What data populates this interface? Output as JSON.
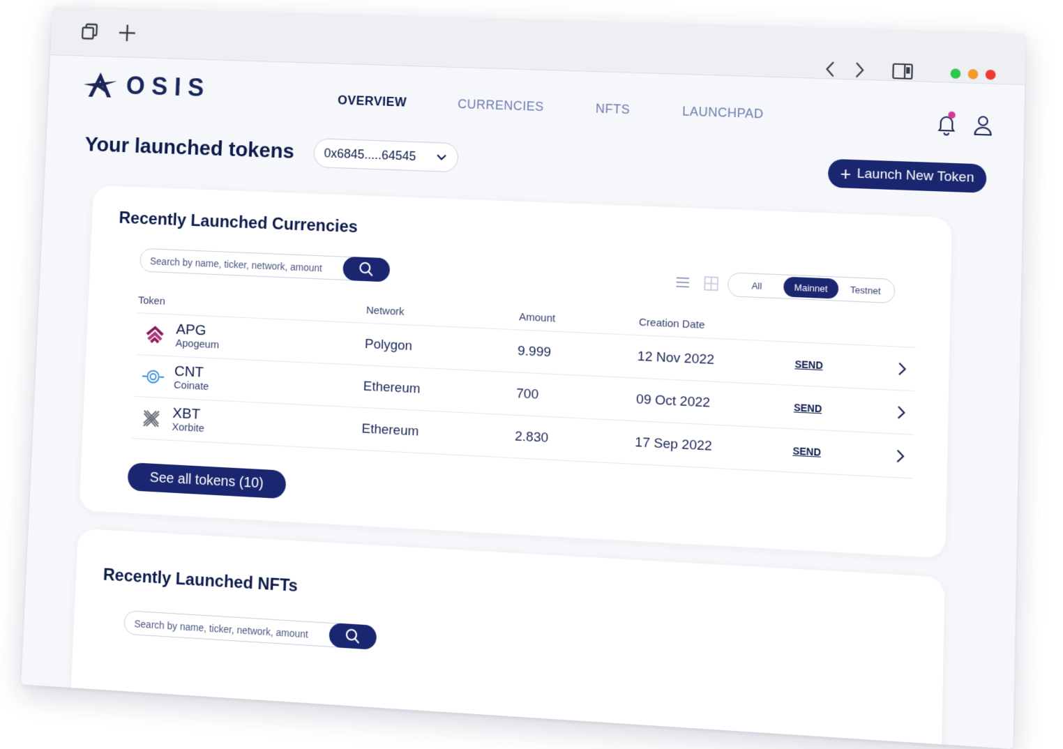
{
  "browser": {
    "icons": [
      "tabs-icon",
      "new-tab-icon",
      "back-icon",
      "forward-icon",
      "sidebar-icon"
    ],
    "traffic_lights": [
      "#2fc84b",
      "#f29c2a",
      "#ee3b33"
    ]
  },
  "header": {
    "logo_text": "OSIS",
    "nav": [
      {
        "label": "OVERVIEW",
        "active": true
      },
      {
        "label": "CURRENCIES",
        "active": false
      },
      {
        "label": "NFTS",
        "active": false
      },
      {
        "label": "LAUNCHPAD",
        "active": false
      }
    ]
  },
  "page": {
    "title": "Your launched tokens",
    "wallet": "0x6845.....64545",
    "launch_button": "Launch New Token"
  },
  "currencies": {
    "title": "Recently Launched Currencies",
    "search_placeholder": "Search by name, ticker, network, amount",
    "filters": [
      {
        "label": "All",
        "active": false
      },
      {
        "label": "Mainnet",
        "active": true
      },
      {
        "label": "Testnet",
        "active": false
      }
    ],
    "columns": {
      "token": "Token",
      "network": "Network",
      "amount": "Amount",
      "date": "Creation Date"
    },
    "rows": [
      {
        "ticker": "APG",
        "name": "Apogeum",
        "network": "Polygon",
        "amount": "9.999",
        "date": "12 Nov 2022",
        "action": "SEND",
        "icon": "apogeum-icon"
      },
      {
        "ticker": "CNT",
        "name": "Coinate",
        "network": "Ethereum",
        "amount": "700",
        "date": "09 Oct 2022",
        "action": "SEND",
        "icon": "coinate-icon"
      },
      {
        "ticker": "XBT",
        "name": "Xorbite",
        "network": "Ethereum",
        "amount": "2.830",
        "date": "17 Sep 2022",
        "action": "SEND",
        "icon": "xorbite-icon"
      }
    ],
    "see_all": "See all tokens (10)"
  },
  "nfts": {
    "title": "Recently Launched NFTs",
    "search_placeholder": "Search by name, ticker, network, amount"
  },
  "colors": {
    "primary": "#1a2770",
    "text": "#0d1b4c",
    "accent": "#d13c9a"
  }
}
